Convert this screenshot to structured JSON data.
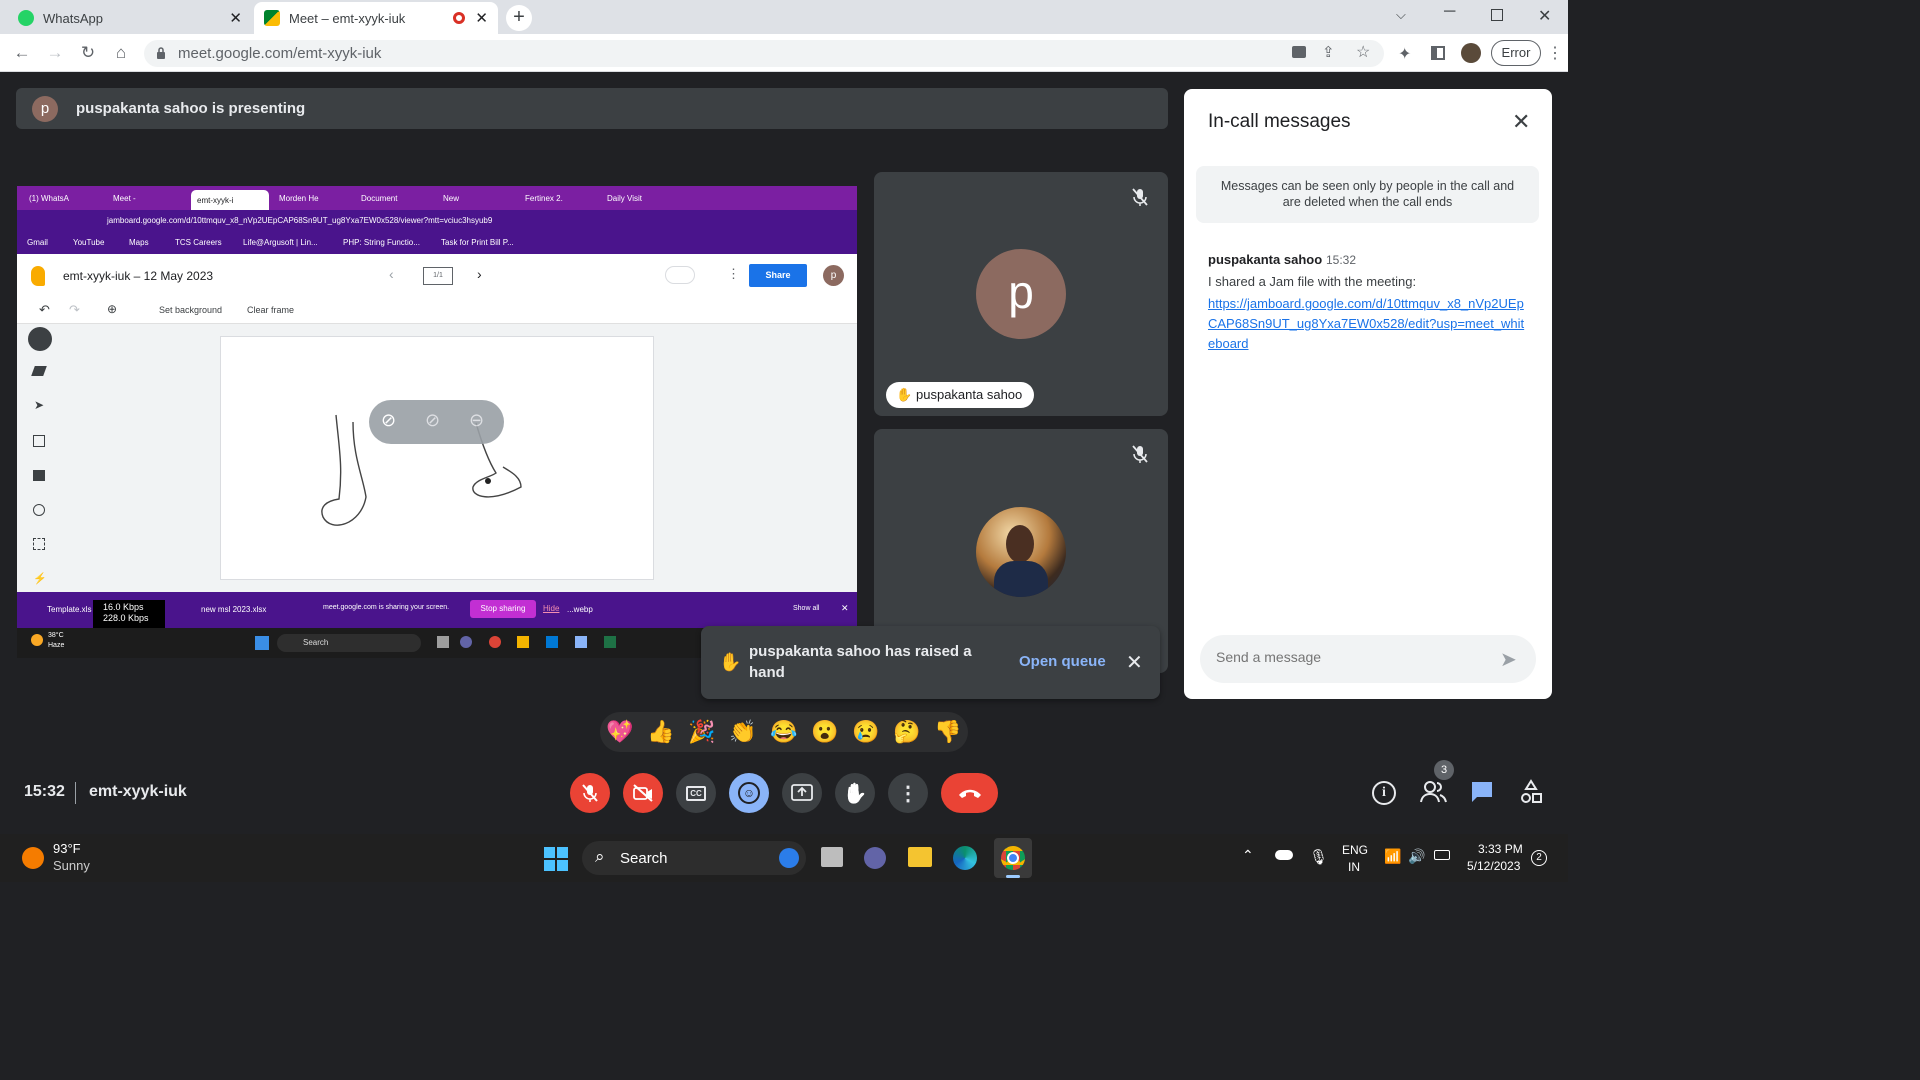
{
  "browser": {
    "tabs": [
      {
        "title": "WhatsApp",
        "active": false
      },
      {
        "title": "Meet – emt-xyyk-iuk",
        "active": true
      }
    ],
    "url": "meet.google.com/emt-xyyk-iuk",
    "profile_status": "Error"
  },
  "meet": {
    "presenting_initial": "p",
    "presenting_text": "puspakanta sahoo is presenting",
    "participants": [
      {
        "name": "puspakanta sahoo",
        "initial": "p",
        "muted": true
      },
      {
        "name": "",
        "muted": true
      }
    ],
    "time": "15:32",
    "meeting_code": "emt-xyyk-iuk",
    "people_count": "3",
    "toast": {
      "text": "puspakanta sahoo has raised a hand",
      "action": "Open queue"
    },
    "reactions": [
      "💖",
      "👍",
      "🎉",
      "👏",
      "😂",
      "😮",
      "😢",
      "🤔",
      "👎"
    ],
    "accent_color": "#8ab4f8",
    "danger_color": "#ea4335"
  },
  "chat": {
    "title": "In-call messages",
    "notice": "Messages can be seen only by people in the call and are deleted when the call ends",
    "messages": [
      {
        "sender": "puspakanta sahoo",
        "time": "15:32",
        "text": "I shared a Jam file with the meeting:",
        "link": "https://jamboard.google.com/d/10ttmquv_x8_nVp2UEpCAP68Sn9UT_ug8Yxa7EW0x528/edit?usp=meet_whiteboard"
      }
    ],
    "input_placeholder": "Send a message"
  },
  "shared_screen": {
    "tabs": [
      "(1) WhatsA",
      "Meet -",
      "emt-xyyk-i",
      "Morden He",
      "Document",
      "New",
      "Fertinex 2.",
      "Daily Visit"
    ],
    "url": "jamboard.google.com/d/10ttmquv_x8_nVp2UEpCAP68Sn9UT_ug8Yxa7EW0x528/viewer?mtt=vciuc3hsyub9",
    "bookmarks": [
      "Gmail",
      "YouTube",
      "Maps",
      "TCS Careers",
      "Life@Argusoft | Lin...",
      "PHP: String Functio...",
      "Task for Print Bill P..."
    ],
    "doc_title": "emt-xyyk-iuk – 12 May 2023",
    "frame_indicator": "1/1",
    "share_label": "Share",
    "avatar_initial": "p",
    "tool_set_background": "Set background",
    "tool_clear_frame": "Clear frame",
    "downloads": [
      "Template.xls",
      "new msl 2023.xlsx",
      "...webp"
    ],
    "net_up": "16.0 Kbps",
    "net_down": "228.0 Kbps",
    "sharing_msg": "meet.google.com is sharing your screen.",
    "stop_sharing": "Stop sharing",
    "hide": "Hide",
    "show_all": "Show all",
    "weather_temp": "38°C",
    "weather_desc": "Haze",
    "search": "Search"
  },
  "taskbar": {
    "weather_temp": "93°F",
    "weather_desc": "Sunny",
    "search": "Search",
    "lang": "ENG",
    "region": "IN",
    "clock_time": "3:33 PM",
    "clock_date": "5/12/2023",
    "notif_count": "2"
  }
}
